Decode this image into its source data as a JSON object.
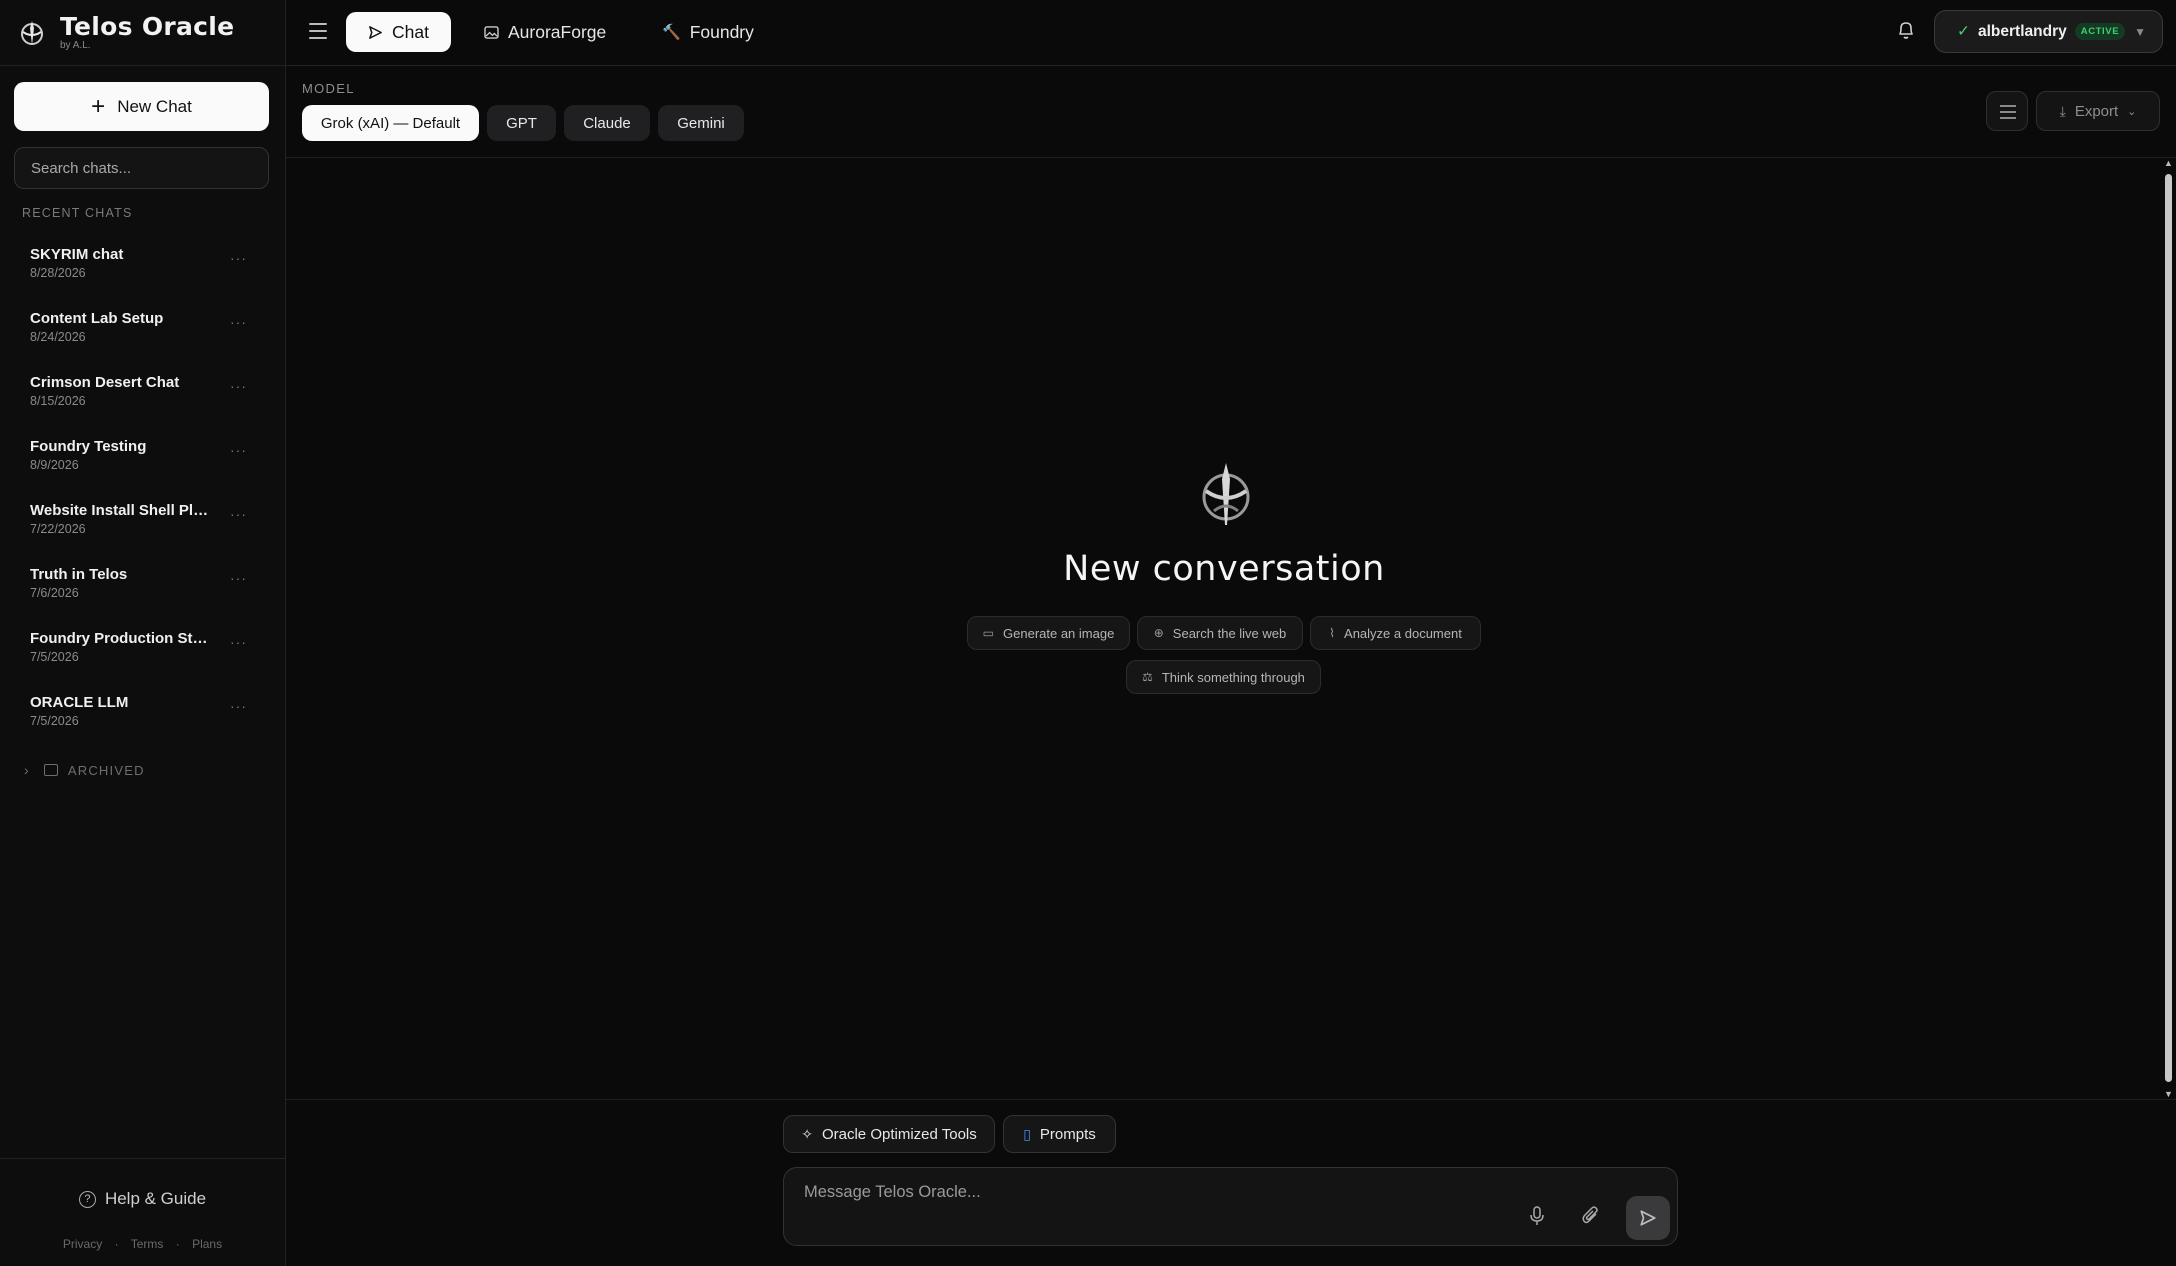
{
  "brand": {
    "title": "Telos Oracle",
    "byline": "by A.L."
  },
  "sidebar": {
    "new_chat_label": "New Chat",
    "search_placeholder": "Search chats...",
    "recent_label": "RECENT CHATS",
    "chats": [
      {
        "name": "SKYRIM chat",
        "date": "8/28/2026"
      },
      {
        "name": "Content Lab Setup",
        "date": "8/24/2026"
      },
      {
        "name": "Crimson Desert Chat",
        "date": "8/15/2026"
      },
      {
        "name": "Foundry Testing",
        "date": "8/9/2026"
      },
      {
        "name": "Website Install Shell Plan...",
        "date": "7/22/2026"
      },
      {
        "name": "Truth in Telos",
        "date": "7/6/2026"
      },
      {
        "name": "Foundry Production Studi...",
        "date": "7/5/2026"
      },
      {
        "name": "ORACLE LLM",
        "date": "7/5/2026"
      }
    ],
    "more_label": "···",
    "archived_label": "ARCHIVED",
    "help_label": "Help & Guide",
    "footer_links": [
      "Privacy",
      "Terms",
      "Plans"
    ],
    "footer_sep": "·"
  },
  "topbar": {
    "tabs": [
      {
        "label": "Chat",
        "icon": "send-icon",
        "active": true
      },
      {
        "label": "AuroraForge",
        "icon": "image-icon",
        "active": false
      },
      {
        "label": "Foundry",
        "icon": "hammer-icon",
        "active": false
      }
    ],
    "user": {
      "check": "✓",
      "name": "albertlandry",
      "badge": "ACTIVE",
      "caret": "▼"
    }
  },
  "model_bar": {
    "label": "MODEL",
    "models": [
      {
        "label": "Grok (xAI) — Default",
        "active": true
      },
      {
        "label": "GPT",
        "active": false
      },
      {
        "label": "Claude",
        "active": false
      },
      {
        "label": "Gemini",
        "active": false
      }
    ],
    "export_label": "Export"
  },
  "main": {
    "headline": "New conversation",
    "chips": [
      {
        "label": "Generate an image",
        "icon": "image-icon"
      },
      {
        "label": "Search the live web",
        "icon": "globe-icon"
      },
      {
        "label": "Analyze a document",
        "icon": "paperclip-icon"
      },
      {
        "label": "Think something through",
        "icon": "scales-icon"
      }
    ]
  },
  "composer": {
    "tools_label": "Oracle Optimized Tools",
    "prompts_label": "Prompts",
    "placeholder": "Message Telos Oracle..."
  },
  "colors": {
    "accent_green": "#3ecf72",
    "prompts_icon": "#4b8df5",
    "background": "#0a0a0b"
  }
}
